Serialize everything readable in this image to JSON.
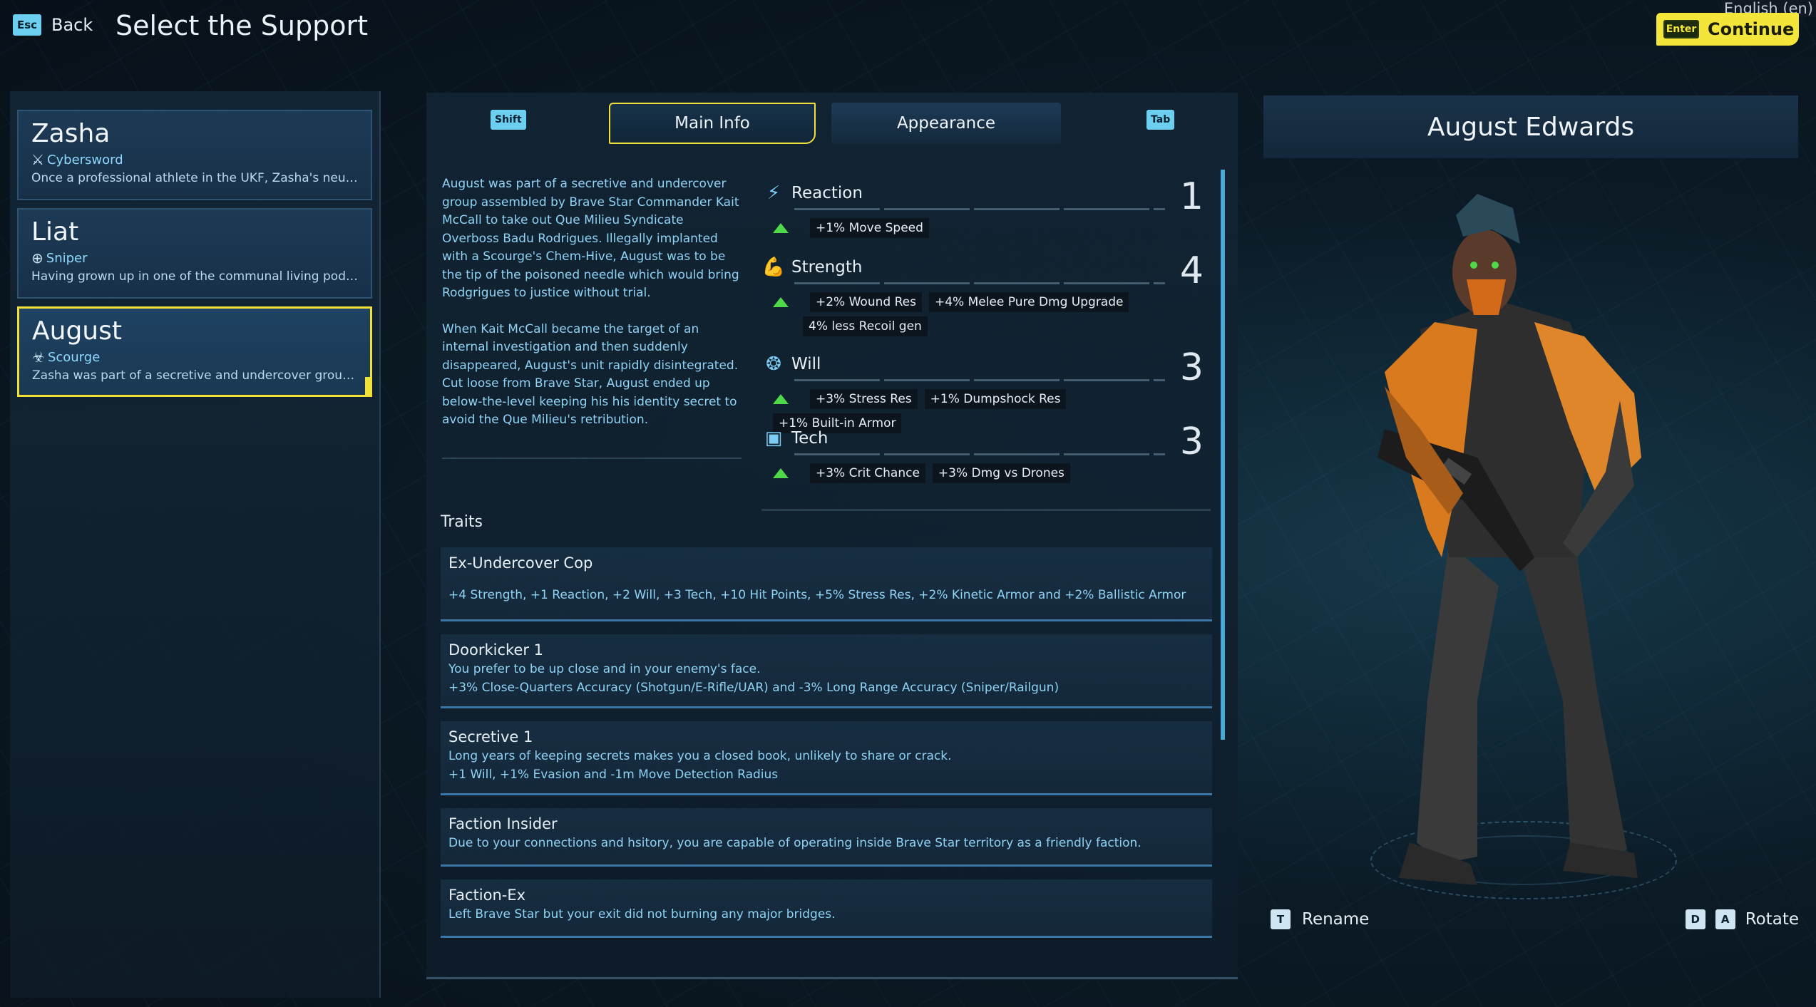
{
  "header": {
    "back_key": "Esc",
    "back_label": "Back",
    "title": "Select the Support",
    "language": "English (en)",
    "continue_key": "Enter",
    "continue_label": "Continue"
  },
  "characters": [
    {
      "name": "Zasha",
      "class": "Cybersword",
      "class_icon": "sword-icon",
      "desc": "Once a professional athlete in the UKF, Zasha's neura...",
      "selected": false
    },
    {
      "name": "Liat",
      "class": "Sniper",
      "class_icon": "crosshair-icon",
      "desc": "Having grown up in one of the communal living pods, k...",
      "selected": false
    },
    {
      "name": "August",
      "class": "Scourge",
      "class_icon": "biohazard-icon",
      "desc": "Zasha was part of a secretive and undercover group ...",
      "selected": true
    }
  ],
  "tabs": {
    "prev_key": "Shift",
    "main_info": "Main Info",
    "appearance": "Appearance",
    "next_key": "Tab"
  },
  "bio": [
    "August was part of a secretive and undercover group assembled by Brave Star Commander Kait McCall to take out Que Milieu Syndicate Overboss Badu Rodrigues. Illegally implanted with a Scourge's Chem-Hive, August was to be the tip of the poisoned needle which would bring Rodgrigues to justice without trial.",
    "When Kait McCall became the target of an internal investigation and then suddenly disappeared, August's unit rapidly disintegrated. Cut loose from Brave Star, August ended up below-the-level keeping his his identity secret to avoid the Que Milieu's retribution."
  ],
  "stats": [
    {
      "name": "Reaction",
      "icon": "lightning-icon",
      "value": "1",
      "bonuses": [
        "+1% Move Speed"
      ]
    },
    {
      "name": "Strength",
      "icon": "flexed-arm-icon",
      "value": "4",
      "bonuses": [
        "+2% Wound Res",
        "+4% Melee Pure Dmg Upgrade",
        "4% less Recoil gen"
      ]
    },
    {
      "name": "Will",
      "icon": "brain-icon",
      "value": "3",
      "bonuses": [
        "+3% Stress Res",
        "+1% Dumpshock Res",
        "+1% Built-in Armor"
      ]
    },
    {
      "name": "Tech",
      "icon": "chip-icon",
      "value": "3",
      "bonuses": [
        "+3% Crit Chance",
        "+3% Dmg vs Drones"
      ]
    }
  ],
  "traits_heading": "Traits",
  "traits": [
    {
      "name": "Ex-Undercover Cop",
      "desc": "",
      "bonus": "+4 Strength, +1 Reaction, +2 Will, +3 Tech, +10 Hit Points, +5% Stress Res, +2% Kinetic Armor and +2% Ballistic Armor"
    },
    {
      "name": "Doorkicker 1",
      "desc": "You prefer to be up close and in your enemy's face.",
      "bonus": "+3% Close-Quarters Accuracy (Shotgun/E-Rifle/UAR) and -3% Long Range Accuracy (Sniper/Railgun)"
    },
    {
      "name": "Secretive 1",
      "desc": "Long years of keeping secrets makes you a closed book, unlikely to share or crack.",
      "bonus": "+1 Will, +1% Evasion and -1m Move Detection Radius"
    },
    {
      "name": "Faction Insider",
      "desc": "Due to your connections and hsitory, you are capable of operating inside Brave Star territory as a friendly faction.",
      "bonus": ""
    },
    {
      "name": "Faction-Ex",
      "desc": "Left Brave Star but your exit did not burning any major bridges.",
      "bonus": ""
    }
  ],
  "preview": {
    "character_name": "August Edwards",
    "rename_key": "T",
    "rename_label": "Rename",
    "rotate_key_left": "D",
    "rotate_key_right": "A",
    "rotate_label": "Rotate"
  },
  "colors": {
    "accent_yellow": "#f0e03a",
    "accent_cyan": "#6ccff0",
    "bonus_green": "#4fd84a",
    "text_blue": "#8fd3f5"
  }
}
